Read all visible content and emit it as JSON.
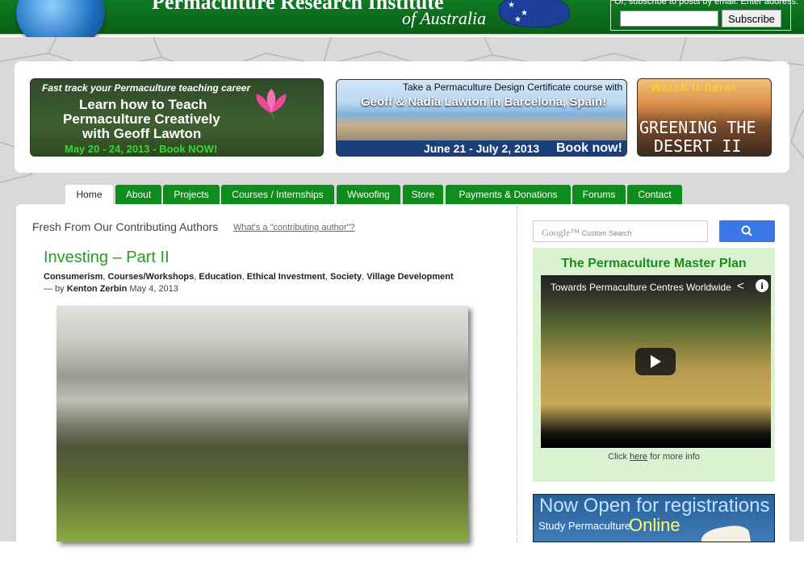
{
  "header": {
    "site_title": "Permaculture Research Institute",
    "site_subtitle": "of Australia",
    "subscribe_text": "Or, subscribe to posts by email. Enter address:",
    "subscribe_label": "Subscribe",
    "email_value": ""
  },
  "banners": {
    "teaching": {
      "line1": "Fast track your Permaculture  teaching career",
      "line2": "Learn how to Teach",
      "line3": "Permaculture Creatively",
      "line4": "with Geoff Lawton",
      "date": "May 20 - 24, 2013 - Book NOW!"
    },
    "barcelona": {
      "line1": "Take a Permaculture Design Certificate course with",
      "line2": "Geoff & Nadia Lawton in Barcelona, Spain!",
      "date": "June 21 - July 2, 2013",
      "cta": "Book now!"
    },
    "desert": {
      "watch": "Watch it here!",
      "title1": "GREENING THE",
      "title2": "DESERT II"
    }
  },
  "nav": {
    "tabs": [
      {
        "label": "Home",
        "active": true
      },
      {
        "label": "About"
      },
      {
        "label": "Projects"
      },
      {
        "label": "Courses / Internships"
      },
      {
        "label": "Wwoofing"
      },
      {
        "label": "Store"
      },
      {
        "label": "Payments & Donations"
      },
      {
        "label": "Forums"
      },
      {
        "label": "Contact"
      }
    ]
  },
  "main": {
    "authors_heading": "Fresh From Our Contributing Authors",
    "authors_link": "What's a \"contributing author\"?",
    "post": {
      "title": "Investing – Part II",
      "categories": [
        "Consumerism",
        "Courses/Workshops",
        "Education",
        "Ethical Investment",
        "Society",
        "Village Development"
      ],
      "by_prefix": "— by",
      "author": "Kenton Zerbin",
      "date": "May 4, 2013"
    }
  },
  "sidebar": {
    "search": {
      "google_label": "Google™",
      "placeholder": "Custom Search"
    },
    "plan": {
      "title": "The Permaculture Master Plan",
      "video_title": "Towards Permaculture Centres Worldwide",
      "click_prefix": "Click",
      "click_link": "here",
      "click_suffix": "for more info"
    },
    "registration": {
      "title": "Now Open for registrations",
      "sub": "Study Permaculture",
      "online": "Online"
    }
  },
  "colors": {
    "header_green": "#0f7a22",
    "nav_green": "#0e8c1c",
    "title_green": "#2a9a2a",
    "plan_bg": "#d9f3d0",
    "search_blue": "#3b78e7"
  }
}
